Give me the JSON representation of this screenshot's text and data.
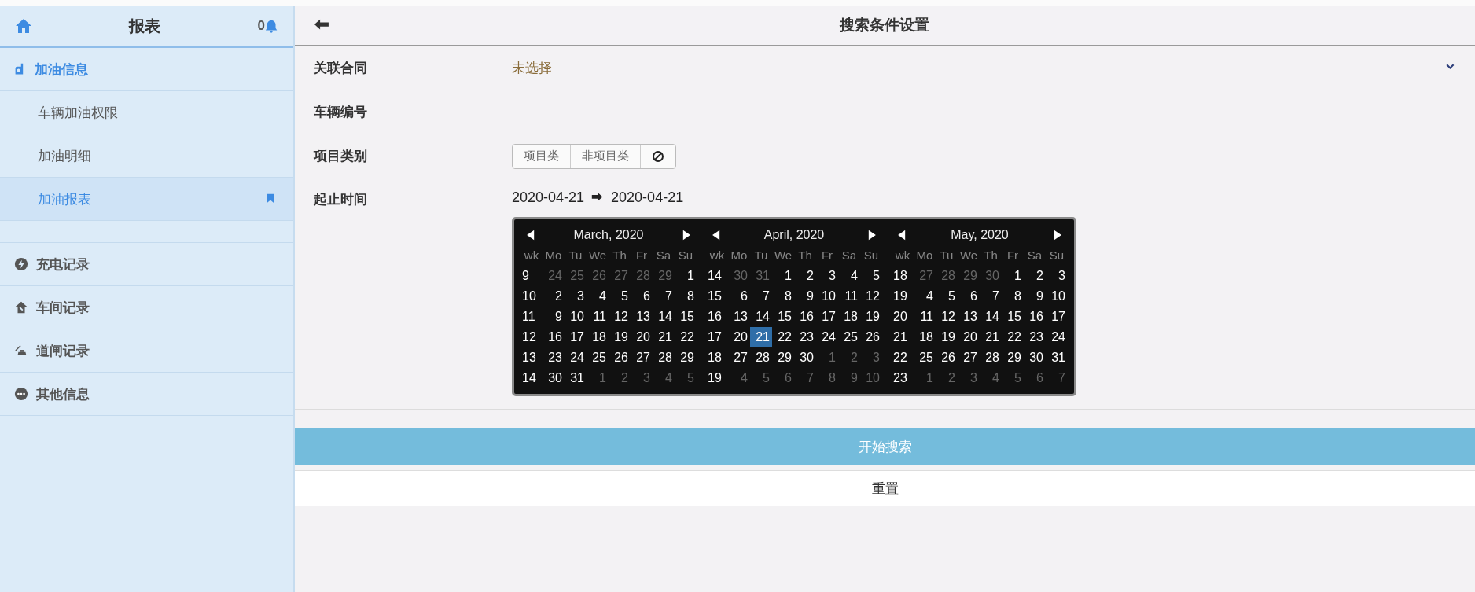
{
  "sidebar": {
    "title": "报表",
    "notification_count": "0",
    "groups": [
      {
        "label": "加油信息",
        "expanded": true,
        "children": [
          {
            "label": "车辆加油权限",
            "selected": false
          },
          {
            "label": "加油明细",
            "selected": false
          },
          {
            "label": "加油报表",
            "selected": true
          }
        ]
      },
      {
        "label": "充电记录",
        "expanded": false
      },
      {
        "label": "车间记录",
        "expanded": false
      },
      {
        "label": "道闸记录",
        "expanded": false
      },
      {
        "label": "其他信息",
        "expanded": false
      }
    ]
  },
  "header": {
    "title": "搜索条件设置"
  },
  "form": {
    "contract": {
      "label": "关联合同",
      "value": "未选择"
    },
    "vehicle_number": {
      "label": "车辆编号"
    },
    "project_type": {
      "label": "项目类别",
      "options": [
        {
          "kind": "text",
          "label": "项目类",
          "selected": false
        },
        {
          "kind": "text",
          "label": "非项目类",
          "selected": false
        },
        {
          "kind": "icon",
          "selected": false
        }
      ]
    },
    "date_range": {
      "label": "起止时间",
      "start": "2020-04-21",
      "end": "2020-04-21"
    }
  },
  "calendar": {
    "months": [
      {
        "title": "March, 2020",
        "weekdays": [
          "wk",
          "Mo",
          "Tu",
          "We",
          "Th",
          "Fr",
          "Sa",
          "Su"
        ],
        "weeks": [
          {
            "week": "9",
            "days": [
              {
                "day": "24",
                "outside": true,
                "selected": false
              },
              {
                "day": "25",
                "outside": true,
                "selected": false
              },
              {
                "day": "26",
                "outside": true,
                "selected": false
              },
              {
                "day": "27",
                "outside": true,
                "selected": false
              },
              {
                "day": "28",
                "outside": true,
                "selected": false
              },
              {
                "day": "29",
                "outside": true,
                "selected": false
              },
              {
                "day": "1",
                "outside": false,
                "selected": false
              }
            ]
          },
          {
            "week": "10",
            "days": [
              {
                "day": "2",
                "outside": false,
                "selected": false
              },
              {
                "day": "3",
                "outside": false,
                "selected": false
              },
              {
                "day": "4",
                "outside": false,
                "selected": false
              },
              {
                "day": "5",
                "outside": false,
                "selected": false
              },
              {
                "day": "6",
                "outside": false,
                "selected": false
              },
              {
                "day": "7",
                "outside": false,
                "selected": false
              },
              {
                "day": "8",
                "outside": false,
                "selected": false
              }
            ]
          },
          {
            "week": "11",
            "days": [
              {
                "day": "9",
                "outside": false,
                "selected": false
              },
              {
                "day": "10",
                "outside": false,
                "selected": false
              },
              {
                "day": "11",
                "outside": false,
                "selected": false
              },
              {
                "day": "12",
                "outside": false,
                "selected": false
              },
              {
                "day": "13",
                "outside": false,
                "selected": false
              },
              {
                "day": "14",
                "outside": false,
                "selected": false
              },
              {
                "day": "15",
                "outside": false,
                "selected": false
              }
            ]
          },
          {
            "week": "12",
            "days": [
              {
                "day": "16",
                "outside": false,
                "selected": false
              },
              {
                "day": "17",
                "outside": false,
                "selected": false
              },
              {
                "day": "18",
                "outside": false,
                "selected": false
              },
              {
                "day": "19",
                "outside": false,
                "selected": false
              },
              {
                "day": "20",
                "outside": false,
                "selected": false
              },
              {
                "day": "21",
                "outside": false,
                "selected": false
              },
              {
                "day": "22",
                "outside": false,
                "selected": false
              }
            ]
          },
          {
            "week": "13",
            "days": [
              {
                "day": "23",
                "outside": false,
                "selected": false
              },
              {
                "day": "24",
                "outside": false,
                "selected": false
              },
              {
                "day": "25",
                "outside": false,
                "selected": false
              },
              {
                "day": "26",
                "outside": false,
                "selected": false
              },
              {
                "day": "27",
                "outside": false,
                "selected": false
              },
              {
                "day": "28",
                "outside": false,
                "selected": false
              },
              {
                "day": "29",
                "outside": false,
                "selected": false
              }
            ]
          },
          {
            "week": "14",
            "days": [
              {
                "day": "30",
                "outside": false,
                "selected": false
              },
              {
                "day": "31",
                "outside": false,
                "selected": false
              },
              {
                "day": "1",
                "outside": true,
                "selected": false
              },
              {
                "day": "2",
                "outside": true,
                "selected": false
              },
              {
                "day": "3",
                "outside": true,
                "selected": false
              },
              {
                "day": "4",
                "outside": true,
                "selected": false
              },
              {
                "day": "5",
                "outside": true,
                "selected": false
              }
            ]
          }
        ]
      },
      {
        "title": "April, 2020",
        "weekdays": [
          "wk",
          "Mo",
          "Tu",
          "We",
          "Th",
          "Fr",
          "Sa",
          "Su"
        ],
        "weeks": [
          {
            "week": "14",
            "days": [
              {
                "day": "30",
                "outside": true,
                "selected": false
              },
              {
                "day": "31",
                "outside": true,
                "selected": false
              },
              {
                "day": "1",
                "outside": false,
                "selected": false
              },
              {
                "day": "2",
                "outside": false,
                "selected": false
              },
              {
                "day": "3",
                "outside": false,
                "selected": false
              },
              {
                "day": "4",
                "outside": false,
                "selected": false
              },
              {
                "day": "5",
                "outside": false,
                "selected": false
              }
            ]
          },
          {
            "week": "15",
            "days": [
              {
                "day": "6",
                "outside": false,
                "selected": false
              },
              {
                "day": "7",
                "outside": false,
                "selected": false
              },
              {
                "day": "8",
                "outside": false,
                "selected": false
              },
              {
                "day": "9",
                "outside": false,
                "selected": false
              },
              {
                "day": "10",
                "outside": false,
                "selected": false
              },
              {
                "day": "11",
                "outside": false,
                "selected": false
              },
              {
                "day": "12",
                "outside": false,
                "selected": false
              }
            ]
          },
          {
            "week": "16",
            "days": [
              {
                "day": "13",
                "outside": false,
                "selected": false
              },
              {
                "day": "14",
                "outside": false,
                "selected": false
              },
              {
                "day": "15",
                "outside": false,
                "selected": false
              },
              {
                "day": "16",
                "outside": false,
                "selected": false
              },
              {
                "day": "17",
                "outside": false,
                "selected": false
              },
              {
                "day": "18",
                "outside": false,
                "selected": false
              },
              {
                "day": "19",
                "outside": false,
                "selected": false
              }
            ]
          },
          {
            "week": "17",
            "days": [
              {
                "day": "20",
                "outside": false,
                "selected": false
              },
              {
                "day": "21",
                "outside": false,
                "selected": true
              },
              {
                "day": "22",
                "outside": false,
                "selected": false
              },
              {
                "day": "23",
                "outside": false,
                "selected": false
              },
              {
                "day": "24",
                "outside": false,
                "selected": false
              },
              {
                "day": "25",
                "outside": false,
                "selected": false
              },
              {
                "day": "26",
                "outside": false,
                "selected": false
              }
            ]
          },
          {
            "week": "18",
            "days": [
              {
                "day": "27",
                "outside": false,
                "selected": false
              },
              {
                "day": "28",
                "outside": false,
                "selected": false
              },
              {
                "day": "29",
                "outside": false,
                "selected": false
              },
              {
                "day": "30",
                "outside": false,
                "selected": false
              },
              {
                "day": "1",
                "outside": true,
                "selected": false
              },
              {
                "day": "2",
                "outside": true,
                "selected": false
              },
              {
                "day": "3",
                "outside": true,
                "selected": false
              }
            ]
          },
          {
            "week": "19",
            "days": [
              {
                "day": "4",
                "outside": true,
                "selected": false
              },
              {
                "day": "5",
                "outside": true,
                "selected": false
              },
              {
                "day": "6",
                "outside": true,
                "selected": false
              },
              {
                "day": "7",
                "outside": true,
                "selected": false
              },
              {
                "day": "8",
                "outside": true,
                "selected": false
              },
              {
                "day": "9",
                "outside": true,
                "selected": false
              },
              {
                "day": "10",
                "outside": true,
                "selected": false
              }
            ]
          }
        ]
      },
      {
        "title": "May, 2020",
        "weekdays": [
          "wk",
          "Mo",
          "Tu",
          "We",
          "Th",
          "Fr",
          "Sa",
          "Su"
        ],
        "weeks": [
          {
            "week": "18",
            "days": [
              {
                "day": "27",
                "outside": true,
                "selected": false
              },
              {
                "day": "28",
                "outside": true,
                "selected": false
              },
              {
                "day": "29",
                "outside": true,
                "selected": false
              },
              {
                "day": "30",
                "outside": true,
                "selected": false
              },
              {
                "day": "1",
                "outside": false,
                "selected": false
              },
              {
                "day": "2",
                "outside": false,
                "selected": false
              },
              {
                "day": "3",
                "outside": false,
                "selected": false
              }
            ]
          },
          {
            "week": "19",
            "days": [
              {
                "day": "4",
                "outside": false,
                "selected": false
              },
              {
                "day": "5",
                "outside": false,
                "selected": false
              },
              {
                "day": "6",
                "outside": false,
                "selected": false
              },
              {
                "day": "7",
                "outside": false,
                "selected": false
              },
              {
                "day": "8",
                "outside": false,
                "selected": false
              },
              {
                "day": "9",
                "outside": false,
                "selected": false
              },
              {
                "day": "10",
                "outside": false,
                "selected": false
              }
            ]
          },
          {
            "week": "20",
            "days": [
              {
                "day": "11",
                "outside": false,
                "selected": false
              },
              {
                "day": "12",
                "outside": false,
                "selected": false
              },
              {
                "day": "13",
                "outside": false,
                "selected": false
              },
              {
                "day": "14",
                "outside": false,
                "selected": false
              },
              {
                "day": "15",
                "outside": false,
                "selected": false
              },
              {
                "day": "16",
                "outside": false,
                "selected": false
              },
              {
                "day": "17",
                "outside": false,
                "selected": false
              }
            ]
          },
          {
            "week": "21",
            "days": [
              {
                "day": "18",
                "outside": false,
                "selected": false
              },
              {
                "day": "19",
                "outside": false,
                "selected": false
              },
              {
                "day": "20",
                "outside": false,
                "selected": false
              },
              {
                "day": "21",
                "outside": false,
                "selected": false
              },
              {
                "day": "22",
                "outside": false,
                "selected": false
              },
              {
                "day": "23",
                "outside": false,
                "selected": false
              },
              {
                "day": "24",
                "outside": false,
                "selected": false
              }
            ]
          },
          {
            "week": "22",
            "days": [
              {
                "day": "25",
                "outside": false,
                "selected": false
              },
              {
                "day": "26",
                "outside": false,
                "selected": false
              },
              {
                "day": "27",
                "outside": false,
                "selected": false
              },
              {
                "day": "28",
                "outside": false,
                "selected": false
              },
              {
                "day": "29",
                "outside": false,
                "selected": false
              },
              {
                "day": "30",
                "outside": false,
                "selected": false
              },
              {
                "day": "31",
                "outside": false,
                "selected": false
              }
            ]
          },
          {
            "week": "23",
            "days": [
              {
                "day": "1",
                "outside": true,
                "selected": false
              },
              {
                "day": "2",
                "outside": true,
                "selected": false
              },
              {
                "day": "3",
                "outside": true,
                "selected": false
              },
              {
                "day": "4",
                "outside": true,
                "selected": false
              },
              {
                "day": "5",
                "outside": true,
                "selected": false
              },
              {
                "day": "6",
                "outside": true,
                "selected": false
              },
              {
                "day": "7",
                "outside": true,
                "selected": false
              }
            ]
          }
        ]
      }
    ]
  },
  "buttons": {
    "search": "开始搜索",
    "reset": "重置"
  }
}
